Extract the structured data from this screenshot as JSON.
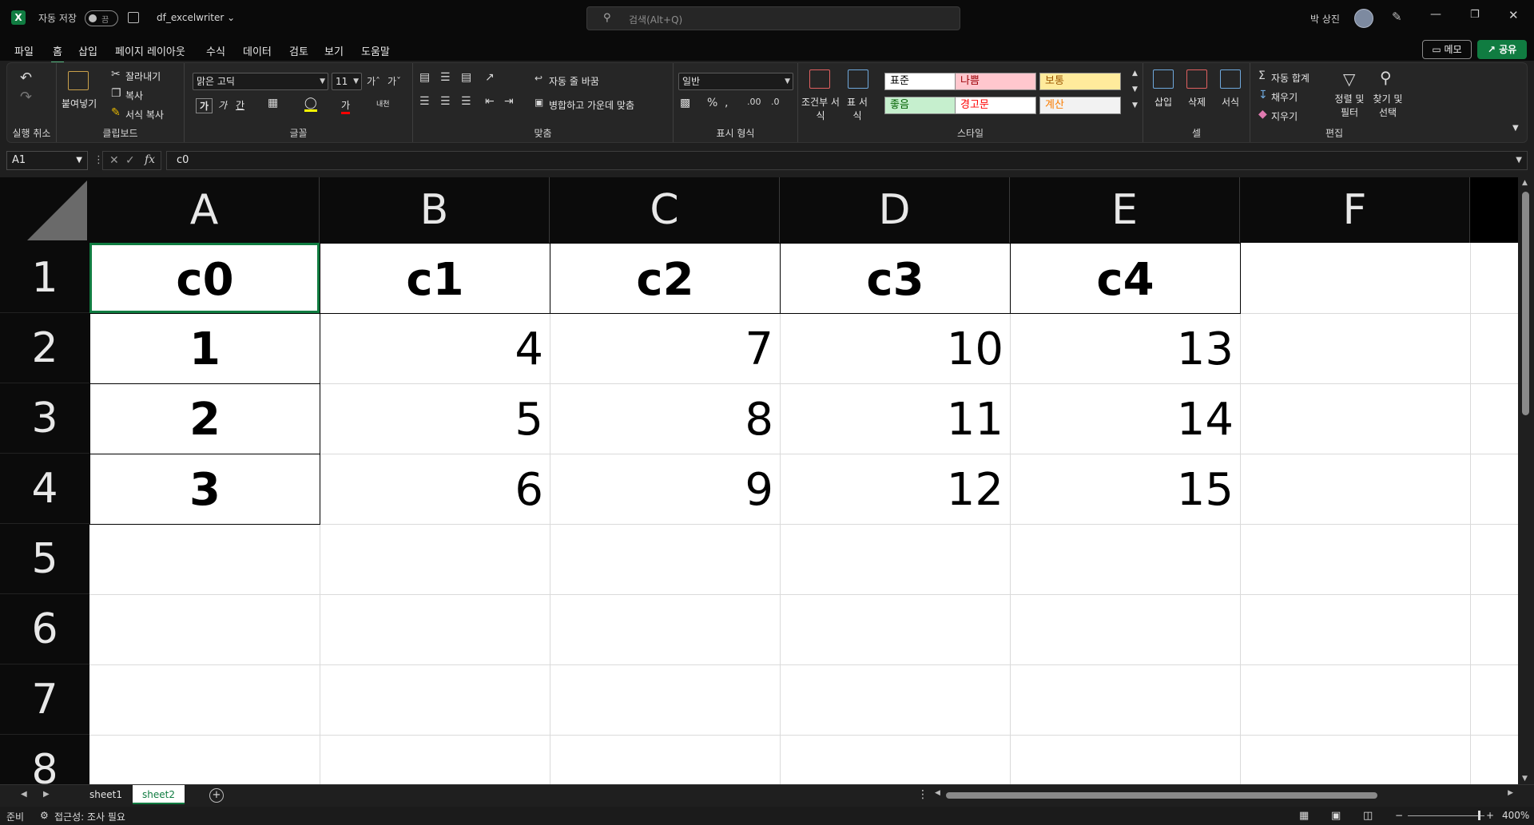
{
  "titlebar": {
    "app_logo": "X",
    "autosave_label": "자동 저장",
    "autosave_state": "끔",
    "doc_title": "df_excelwriter ⌄",
    "search_placeholder": "검색(Alt+Q)",
    "user_name": "박 상진"
  },
  "menu": {
    "tabs": [
      "파일",
      "홈",
      "삽입",
      "페이지 레이아웃",
      "수식",
      "데이터",
      "검토",
      "보기",
      "도움말"
    ],
    "active_tab": "홈",
    "memo_label": "메모",
    "share_label": "공유"
  },
  "ribbon": {
    "undo": {
      "label": "실행 취소"
    },
    "clipboard": {
      "label": "클립보드",
      "paste": "붙여넣기",
      "cut": "잘라내기",
      "copy": "복사",
      "format_painter": "서식 복사"
    },
    "font": {
      "label": "글꼴",
      "font_name": "맑은 고딕",
      "font_size": "11",
      "bold": "가",
      "italic": "가",
      "underline": "간",
      "font_color": "가",
      "phonetic": "내천"
    },
    "alignment": {
      "label": "맞춤",
      "wrap_text": "자동 줄 바꿈",
      "merge_center": "병합하고 가운데 맞춤"
    },
    "number": {
      "label": "표시 형식",
      "format": "일반"
    },
    "styles": {
      "label": "스타일",
      "conditional": "조건부 서식",
      "table": "표 서식",
      "cells": [
        {
          "name": "표준",
          "bg": "#ffffff",
          "fg": "#000000"
        },
        {
          "name": "나쁨",
          "bg": "#ffc7ce",
          "fg": "#9c0006"
        },
        {
          "name": "보통",
          "bg": "#ffeb9c",
          "fg": "#9c5700"
        },
        {
          "name": "좋음",
          "bg": "#c6efce",
          "fg": "#006100"
        },
        {
          "name": "경고문",
          "bg": "#ffffff",
          "fg": "#ff0000"
        },
        {
          "name": "계산",
          "bg": "#f2f2f2",
          "fg": "#fa7d00"
        }
      ]
    },
    "cells_group": {
      "label": "셀",
      "insert": "삽입",
      "delete": "삭제",
      "format": "서식"
    },
    "editing": {
      "label": "편집",
      "autosum": "자동 합계",
      "fill": "채우기",
      "clear": "지우기",
      "sort_filter": "정렬 및 필터",
      "find_select": "찾기 및 선택"
    }
  },
  "formula_bar": {
    "name_box": "A1",
    "fx_label": "fx",
    "content": "c0"
  },
  "grid": {
    "columns": [
      "A",
      "B",
      "C",
      "D",
      "E",
      "F"
    ],
    "rows": [
      "1",
      "2",
      "3",
      "4",
      "5",
      "6",
      "7",
      "8"
    ],
    "headers": [
      "c0",
      "c1",
      "c2",
      "c3",
      "c4"
    ],
    "index_values": [
      "1",
      "2",
      "3"
    ],
    "data": [
      [
        "4",
        "7",
        "10",
        "13"
      ],
      [
        "5",
        "8",
        "11",
        "14"
      ],
      [
        "6",
        "9",
        "12",
        "15"
      ]
    ]
  },
  "sheets": {
    "tabs": [
      "sheet1",
      "sheet2"
    ],
    "active": "sheet2"
  },
  "status": {
    "ready": "준비",
    "accessibility": "접근성: 조사 필요",
    "zoom": "400%"
  },
  "colors": {
    "accent": "#107c41",
    "ribbon_bg": "#262626",
    "titlebar_bg": "#0a0a0a"
  }
}
